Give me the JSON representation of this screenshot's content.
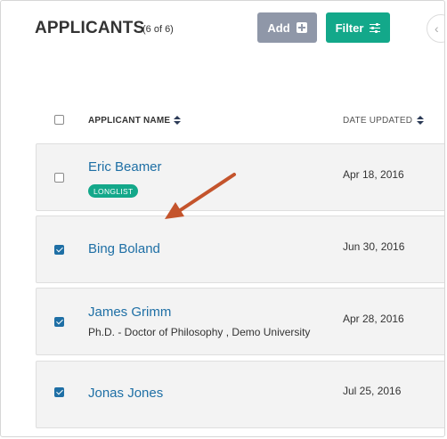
{
  "header": {
    "title": "APPLICANTS",
    "count": "(6 of 6)",
    "add_label": "Add",
    "filter_label": "Filter",
    "scroll_glyph": "‹"
  },
  "columns": {
    "name": "APPLICANT NAME",
    "date": "DATE UPDATED"
  },
  "rows": [
    {
      "name": "Eric Beamer",
      "date": "Apr 18, 2016",
      "tag": "LONGLIST",
      "subtitle": "",
      "checked": false
    },
    {
      "name": "Bing Boland",
      "date": "Jun 30, 2016",
      "tag": "",
      "subtitle": "",
      "checked": true
    },
    {
      "name": "James Grimm",
      "date": "Apr 28, 2016",
      "tag": "",
      "subtitle": "Ph.D. - Doctor of Philosophy , Demo University",
      "checked": true
    },
    {
      "name": "Jonas Jones",
      "date": "Jul 25, 2016",
      "tag": "",
      "subtitle": "",
      "checked": true
    }
  ],
  "colors": {
    "accent": "#13a88a",
    "link": "#1e6fa5",
    "add_button": "#8f97a8",
    "annotation_arrow": "#c4542c"
  },
  "icons": {
    "add": "plus-square-icon",
    "filter": "sliders-icon",
    "sort": "sort-icon",
    "scroll": "chevron-left-icon"
  }
}
